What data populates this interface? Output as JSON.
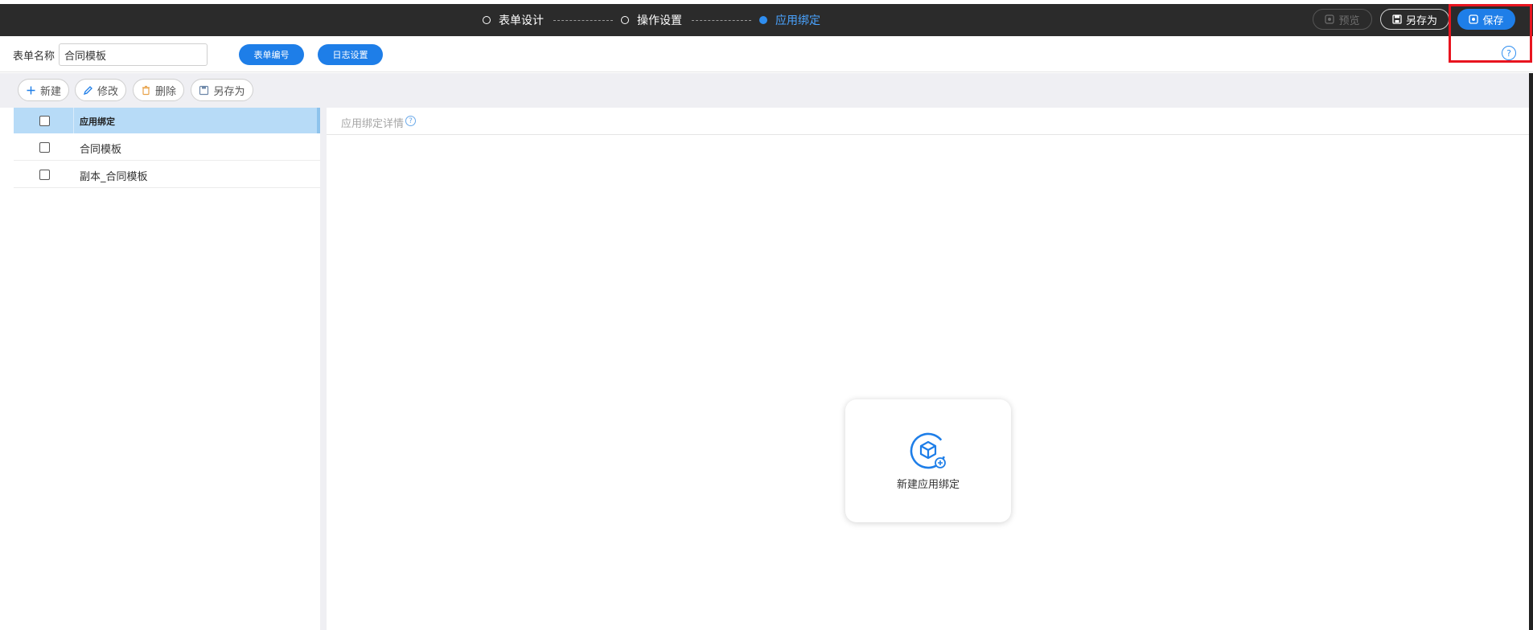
{
  "steps": [
    {
      "label": "表单设计",
      "active": false
    },
    {
      "label": "操作设置",
      "active": false
    },
    {
      "label": "应用绑定",
      "active": true
    }
  ],
  "topbar": {
    "preview_label": "预览",
    "saveas_label": "另存为",
    "save_label": "保存"
  },
  "form": {
    "name_label": "表单名称",
    "name_value": "合同模板",
    "number_button": "表单编号",
    "log_button": "日志设置"
  },
  "toolbar": {
    "new_label": "新建",
    "edit_label": "修改",
    "delete_label": "删除",
    "saveas_label": "另存为"
  },
  "list": {
    "header": "应用绑定",
    "items": [
      {
        "label": "合同模板"
      },
      {
        "label": "副本_合同模板"
      }
    ]
  },
  "detail": {
    "title": "应用绑定详情",
    "card_label": "新建应用绑定"
  },
  "colors": {
    "accent": "#1e7ee8",
    "topbar": "#2b2b2b",
    "highlight": "#e8141f",
    "list_header": "#b7dbf7"
  }
}
